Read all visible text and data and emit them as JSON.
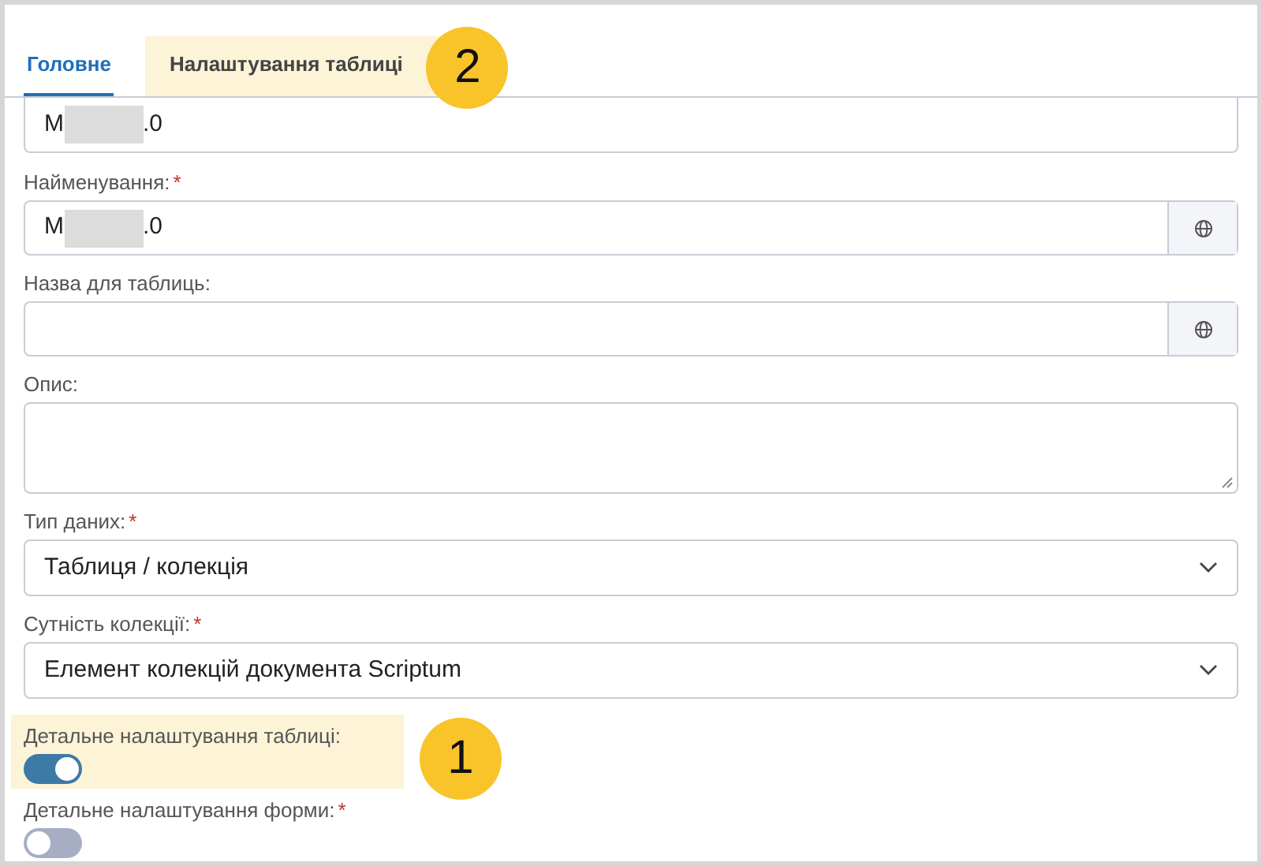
{
  "tabs": [
    {
      "label": "Головне",
      "selected": true,
      "highlighted": false
    },
    {
      "label": "Налаштування таблиці",
      "selected": false,
      "highlighted": true,
      "badge": "2"
    }
  ],
  "fields": [
    {
      "kind": "text",
      "value_start": "M",
      "value_end": ".0",
      "redacted": true,
      "translate": false,
      "clipped": true
    },
    {
      "kind": "text",
      "label": "Найменування:",
      "mark": "*",
      "value_start": "M",
      "value_end": ".0",
      "redacted": true,
      "translate": true
    },
    {
      "kind": "text",
      "label": "Назва для таблиць:",
      "translate": true
    },
    {
      "kind": "textarea",
      "label": "Опис:"
    },
    {
      "kind": "select",
      "label": "Тип даних:",
      "mark": "*",
      "value": "Таблиця / колекція"
    },
    {
      "kind": "select",
      "label": "Сутність колекції:",
      "mark": "*",
      "value": "Елемент колекцій документа Scriptum"
    },
    {
      "kind": "toggle",
      "label": "Детальне налаштування таблиці:",
      "on": true,
      "highlighted": true,
      "badge": "1"
    },
    {
      "kind": "toggle",
      "label": "Детальне налаштування форми:",
      "mark": "*",
      "on": false
    }
  ]
}
